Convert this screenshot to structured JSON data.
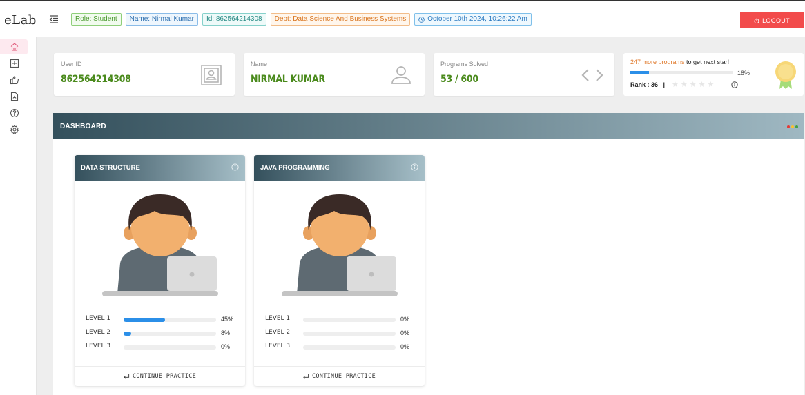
{
  "app": {
    "logo": "eLab"
  },
  "header": {
    "role": "Role: Student",
    "name": "Name: Nirmal Kumar",
    "id": "Id: 862564214308",
    "dept": "Dept: Data Science And Business Systems",
    "datetime": "October 10th 2024, 10:26:22 Am",
    "logout_label": "LOGOUT"
  },
  "sidebar": {
    "items": [
      {
        "name": "home",
        "icon": "home-icon",
        "active": true
      },
      {
        "name": "add",
        "icon": "plus-square-icon"
      },
      {
        "name": "like",
        "icon": "thumbs-up-icon"
      },
      {
        "name": "report",
        "icon": "file-icon"
      },
      {
        "name": "help",
        "icon": "help-circle-icon"
      },
      {
        "name": "settings",
        "icon": "gear-icon"
      }
    ]
  },
  "stats": {
    "user_id": {
      "label": "User ID",
      "value": "862564214308",
      "icon": "id-card-icon"
    },
    "name": {
      "label": "Name",
      "value": "NIRMAL KUMAR",
      "icon": "user-icon"
    },
    "programs": {
      "label": "Programs Solved",
      "value": "53 / 600",
      "icon": "code-icon"
    },
    "star": {
      "highlight": "247 more programs",
      "message": " to get next star!",
      "progress_fraction": 0.18,
      "progress_label": "18%",
      "rank_label": "Rank : 36",
      "separator": "|",
      "stars_total": 5,
      "stars_filled": 0
    }
  },
  "dashboard": {
    "title": "DASHBOARD",
    "courses": [
      {
        "title": "DATA STRUCTURE",
        "levels": [
          {
            "name": "LEVEL 1",
            "fraction": 0.45,
            "label": "45%"
          },
          {
            "name": "LEVEL 2",
            "fraction": 0.08,
            "label": "8%"
          },
          {
            "name": "LEVEL 3",
            "fraction": 0.0,
            "label": "0%"
          }
        ],
        "action": "CONTINUE PRACTICE"
      },
      {
        "title": "JAVA PROGRAMMING",
        "levels": [
          {
            "name": "LEVEL 1",
            "fraction": 0.0,
            "label": "0%"
          },
          {
            "name": "LEVEL 2",
            "fraction": 0.0,
            "label": "0%"
          },
          {
            "name": "LEVEL 3",
            "fraction": 0.0,
            "label": "0%"
          }
        ],
        "action": "CONTINUE PRACTICE"
      }
    ]
  },
  "colors": {
    "accent": "#2b8fe8",
    "logout": "#f24b4b",
    "value_green": "#4a8a1c",
    "dots": [
      "#e53935",
      "#fbc02d",
      "#43a047"
    ]
  }
}
